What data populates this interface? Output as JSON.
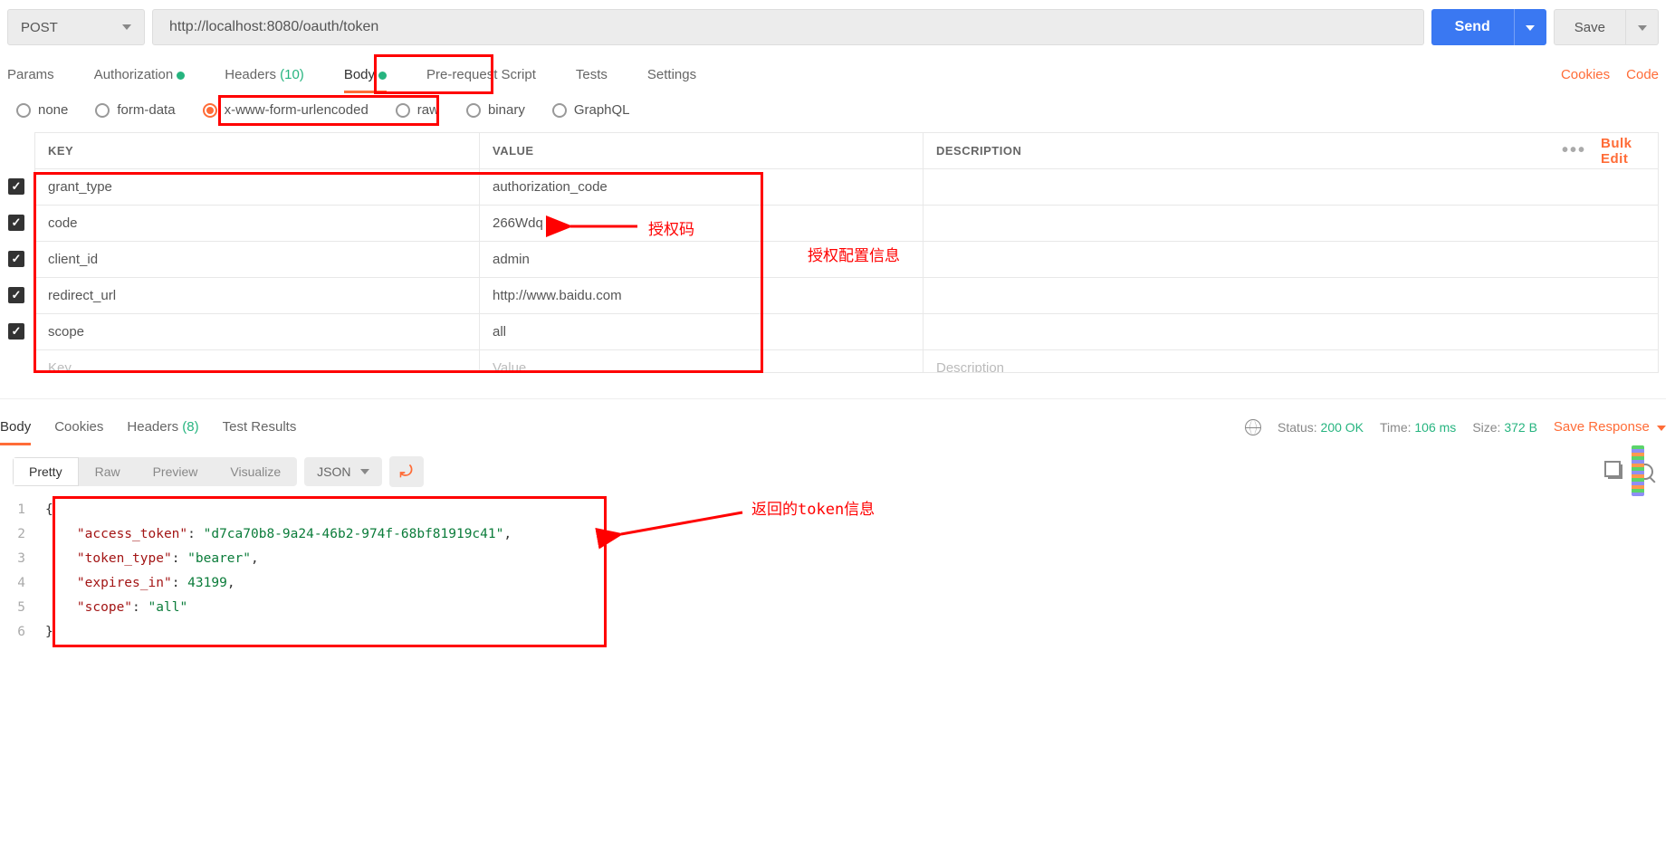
{
  "request": {
    "method": "POST",
    "url": "http://localhost:8080/oauth/token",
    "send_label": "Send",
    "save_label": "Save"
  },
  "tabs": {
    "items": [
      {
        "label": "Params"
      },
      {
        "label": "Authorization",
        "indicator": "dot"
      },
      {
        "label": "Headers",
        "count": "(10)"
      },
      {
        "label": "Body",
        "indicator": "dot",
        "active": true
      },
      {
        "label": "Pre-request Script"
      },
      {
        "label": "Tests"
      },
      {
        "label": "Settings"
      }
    ],
    "cookies_label": "Cookies",
    "code_label": "Code"
  },
  "body_types": [
    {
      "label": "none"
    },
    {
      "label": "form-data"
    },
    {
      "label": "x-www-form-urlencoded",
      "selected": true
    },
    {
      "label": "raw"
    },
    {
      "label": "binary"
    },
    {
      "label": "GraphQL"
    }
  ],
  "table": {
    "headers": {
      "key": "KEY",
      "value": "VALUE",
      "desc": "DESCRIPTION"
    },
    "bulk_edit": "Bulk Edit",
    "rows": [
      {
        "key": "grant_type",
        "value": "authorization_code"
      },
      {
        "key": "code",
        "value": "266Wdq"
      },
      {
        "key": "client_id",
        "value": "admin"
      },
      {
        "key": "redirect_url",
        "value": "http://www.baidu.com"
      },
      {
        "key": "scope",
        "value": "all"
      }
    ],
    "placeholder": {
      "key": "Key",
      "value": "Value",
      "desc": "Description"
    }
  },
  "annotations": {
    "auth_code": "授权码",
    "auth_config": "授权配置信息",
    "token_info": "返回的token信息"
  },
  "response": {
    "tabs": [
      {
        "label": "Body",
        "active": true
      },
      {
        "label": "Cookies"
      },
      {
        "label": "Headers",
        "count": "(8)"
      },
      {
        "label": "Test Results"
      }
    ],
    "meta": {
      "status_label": "Status:",
      "status_value": "200 OK",
      "time_label": "Time:",
      "time_value": "106 ms",
      "size_label": "Size:",
      "size_value": "372 B"
    },
    "save_response": "Save Response",
    "view_modes": [
      "Pretty",
      "Raw",
      "Preview",
      "Visualize"
    ],
    "format": "JSON",
    "json": {
      "access_token": "d7ca70b8-9a24-46b2-974f-68bf81919c41",
      "token_type": "bearer",
      "expires_in": 43199,
      "scope": "all"
    }
  }
}
